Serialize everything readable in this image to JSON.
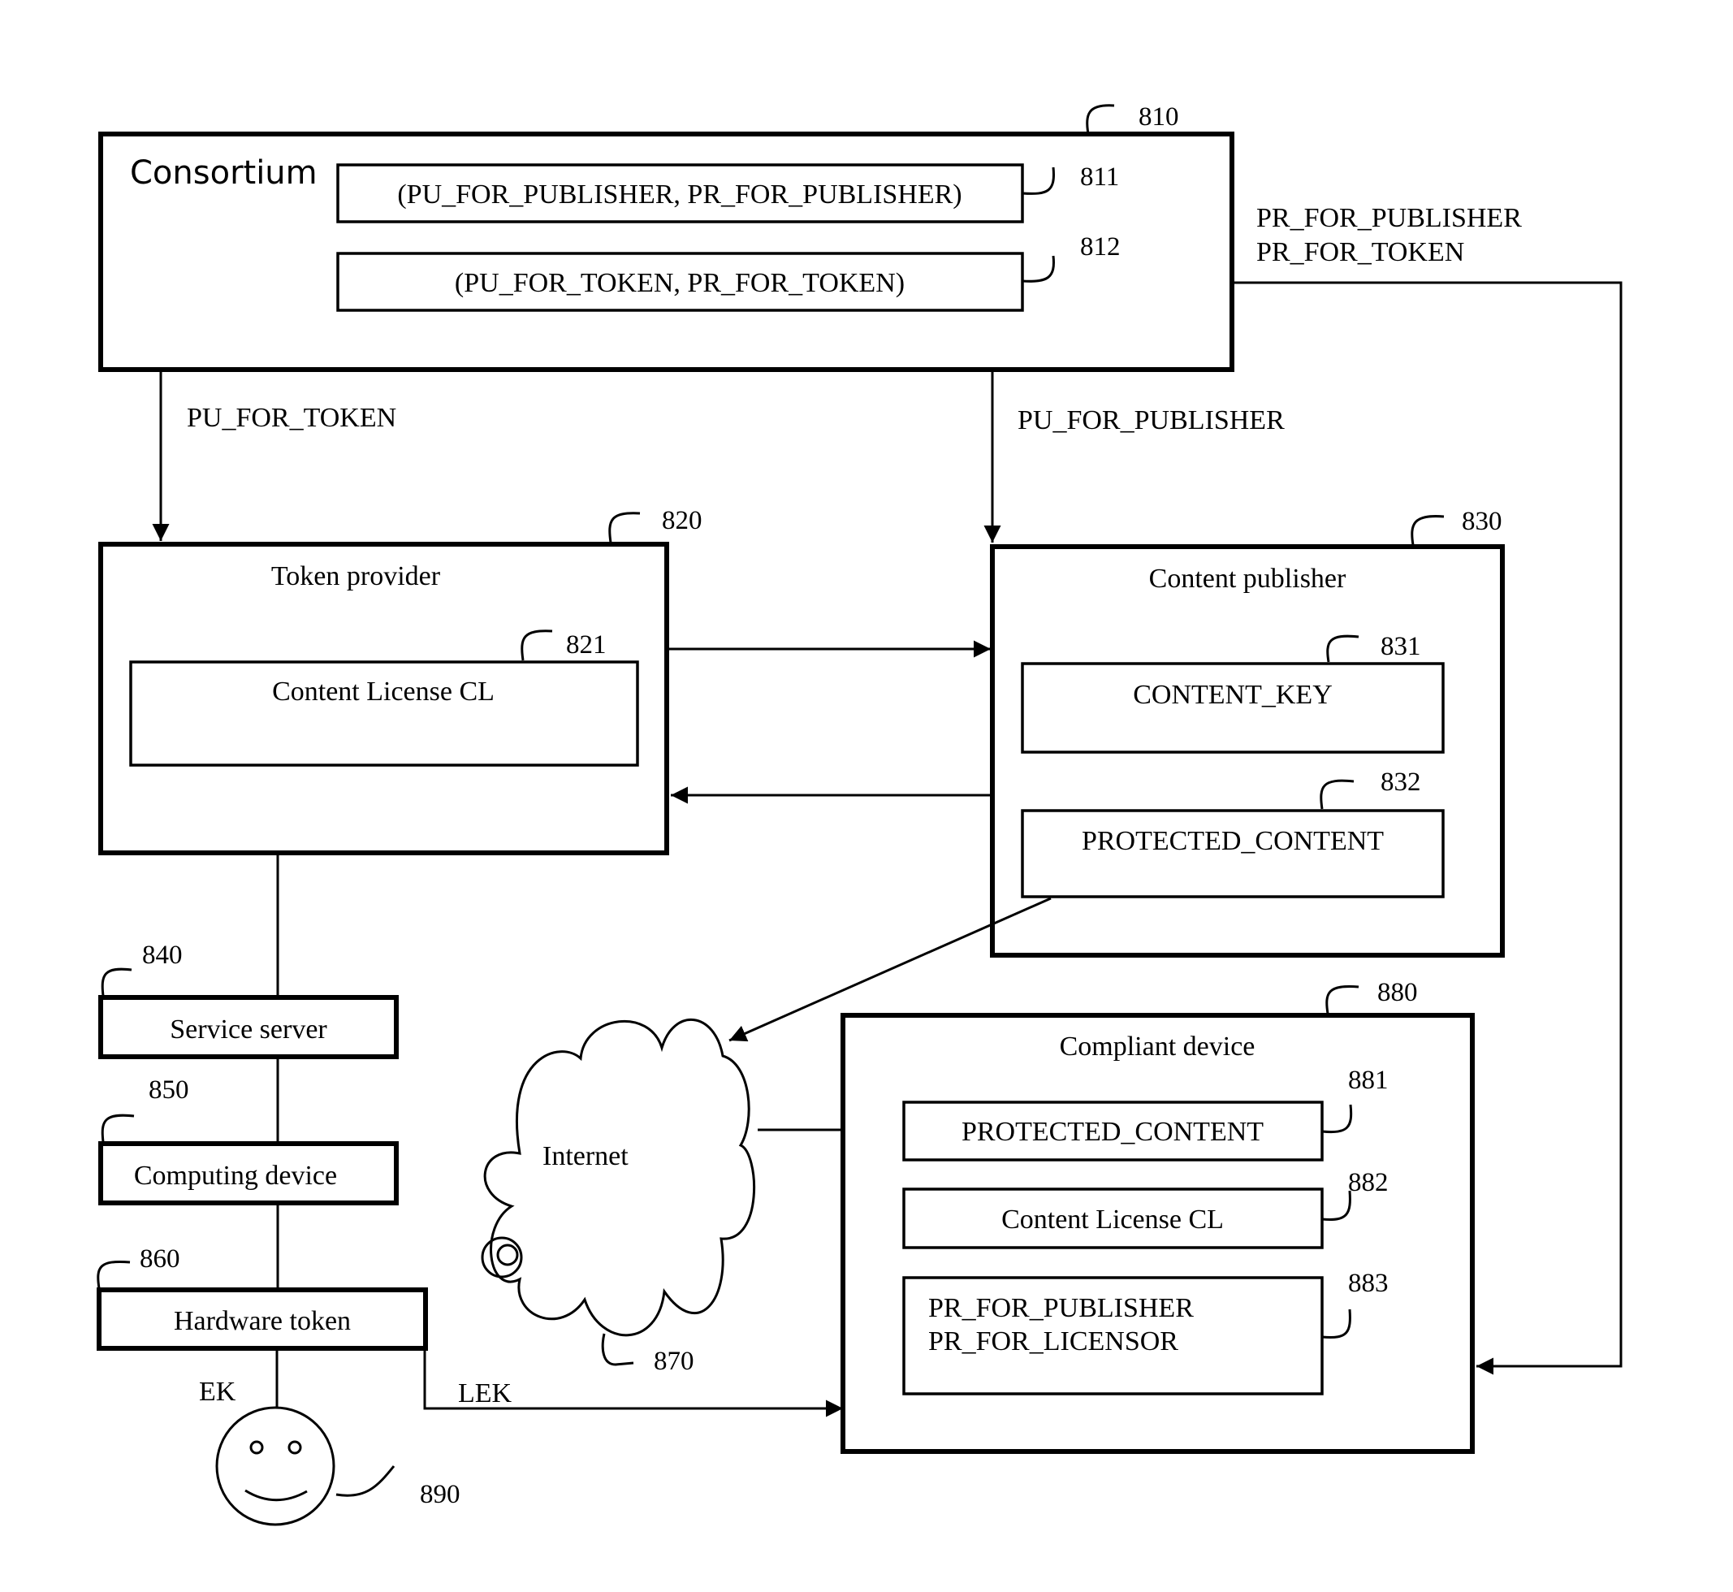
{
  "consortium": {
    "ref": "810",
    "title": "Consortium",
    "pair1": {
      "ref": "811",
      "text": "(PU_FOR_PUBLISHER, PR_FOR_PUBLISHER)"
    },
    "pair2": {
      "ref": "812",
      "text": "(PU_FOR_TOKEN, PR_FOR_TOKEN)"
    }
  },
  "edges": {
    "to_token_provider": "PU_FOR_TOKEN",
    "to_publisher": "PU_FOR_PUBLISHER",
    "to_compliant_line1": "PR_FOR_PUBLISHER",
    "to_compliant_line2": "PR_FOR_TOKEN",
    "ek": "EK",
    "lek": "LEK"
  },
  "token_provider": {
    "ref": "820",
    "title": "Token provider",
    "license": {
      "ref": "821",
      "text": "Content License CL"
    }
  },
  "content_publisher": {
    "ref": "830",
    "title": "Content publisher",
    "key": {
      "ref": "831",
      "text": "CONTENT_KEY"
    },
    "protected": {
      "ref": "832",
      "text": "PROTECTED_CONTENT"
    }
  },
  "service_server": {
    "ref": "840",
    "text": "Service server"
  },
  "computing_device": {
    "ref": "850",
    "text": "Computing device"
  },
  "hardware_token": {
    "ref": "860",
    "text": "Hardware token"
  },
  "internet": {
    "ref": "870",
    "text": "Internet"
  },
  "compliant_device": {
    "ref": "880",
    "title": "Compliant device",
    "protected": {
      "ref": "881",
      "text": "PROTECTED_CONTENT"
    },
    "license": {
      "ref": "882",
      "text": "Content License CL"
    },
    "keys": {
      "ref": "883",
      "line1": "PR_FOR_PUBLISHER",
      "line2": "PR_FOR_LICENSOR"
    }
  },
  "user": {
    "ref": "890"
  }
}
